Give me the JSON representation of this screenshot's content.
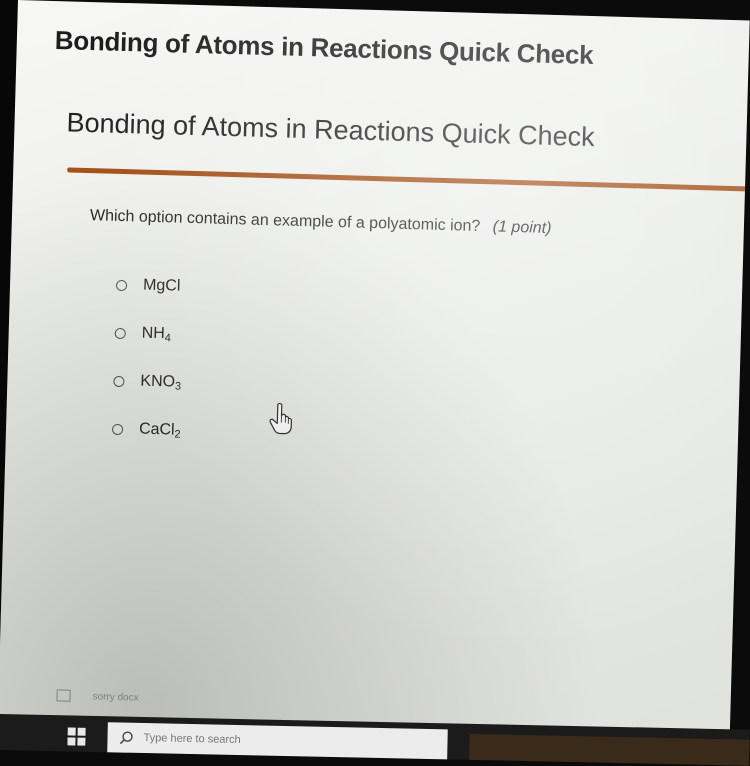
{
  "header": {
    "app_title": "Bonding of Atoms in Reactions Quick Check"
  },
  "quiz": {
    "title": "Bonding of Atoms in Reactions Quick Check",
    "question": {
      "text": "Which option contains an example of a polyatomic ion?",
      "points": "(1 point)",
      "options": [
        {
          "base": "MgCl",
          "sub": ""
        },
        {
          "base": "NH",
          "sub": "4"
        },
        {
          "base": "KNO",
          "sub": "3"
        },
        {
          "base": "CaCl",
          "sub": "2"
        }
      ]
    }
  },
  "footer": {
    "note": "sorry docx"
  },
  "taskbar": {
    "search_placeholder": "Type here to search"
  },
  "colors": {
    "divider": "#a4511a",
    "taskbar": "#1b1b1b"
  },
  "icons": {
    "cursor": "hand-pointer-icon",
    "start": "windows-start-icon",
    "search": "search-icon"
  }
}
